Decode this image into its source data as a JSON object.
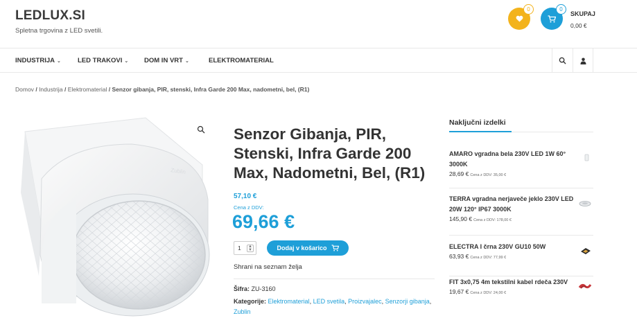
{
  "site": {
    "logo": "LEDLUX.SI",
    "tagline": "Spletna trgovina z LED svetili."
  },
  "header": {
    "wishlist_count": "0",
    "cart_count": "0",
    "cart_label": "SKUPAJ",
    "cart_total": "0,00 €"
  },
  "nav": {
    "items": [
      {
        "label": "INDUSTRIJA",
        "chevron": "⌄"
      },
      {
        "label": "LED TRAKOVI",
        "chevron": "⌄"
      },
      {
        "label": "DOM IN VRT",
        "chevron": "⌄"
      },
      {
        "label": "ELEKTROMATERIAL",
        "chevron": ""
      }
    ]
  },
  "breadcrumb": {
    "items": [
      "Domov",
      "Industrija",
      "Elektromaterial"
    ],
    "separator": "/",
    "current": "Senzor gibanja, PIR, stenski, Infra Garde 200 Max, nadometni, bel, (R1)"
  },
  "product": {
    "title": "Senzor Gibanja, PIR, Stenski, Infra Garde 200 Max, Nadometni, Bel, (R1)",
    "price_net": "57,10 €",
    "price_note": "Cena z DDV:",
    "price_gross": "69,66 €",
    "quantity": "1",
    "add_to_cart": "Dodaj v košarico",
    "wishlist_link": "Shrani na seznam želja",
    "sku_label": "Šifra:",
    "sku": "ZU-3160",
    "categories_label": "Kategorije:",
    "categories": [
      "Elektromaterial",
      "LED svetila",
      "Proizvajalec",
      "Senzorji gibanja",
      "Zublin"
    ]
  },
  "sidebar": {
    "title": "Naključni izdelki",
    "items": [
      {
        "name": "AMARO vgradna bela 230V LED 1W 60° 3000K",
        "price": "28,69 €",
        "note": "Cena z DDV: 35,00 €"
      },
      {
        "name": "TERRA vgradna nerjaveče jeklo 230V LED 20W 120° IP67 3000K",
        "price": "145,90 €",
        "note": "Cena z DDV: 178,00 €"
      },
      {
        "name": "ELECTRA I črna 230V GU10 50W",
        "price": "63,93 €",
        "note": "Cena z DDV: 77,99 €"
      },
      {
        "name": "FIT 3x0,75 4m tekstilni kabel rdeča 230V",
        "price": "19,67 €",
        "note": "Cena z DDV: 24,00 €"
      }
    ]
  },
  "icons": {
    "wishlist": "heart-icon",
    "cart": "cart-icon",
    "search": "search-icon",
    "user": "user-icon",
    "zoom": "magnifier-icon"
  },
  "colors": {
    "accent": "#1e9fd8",
    "wishlist": "#f3b31c"
  }
}
